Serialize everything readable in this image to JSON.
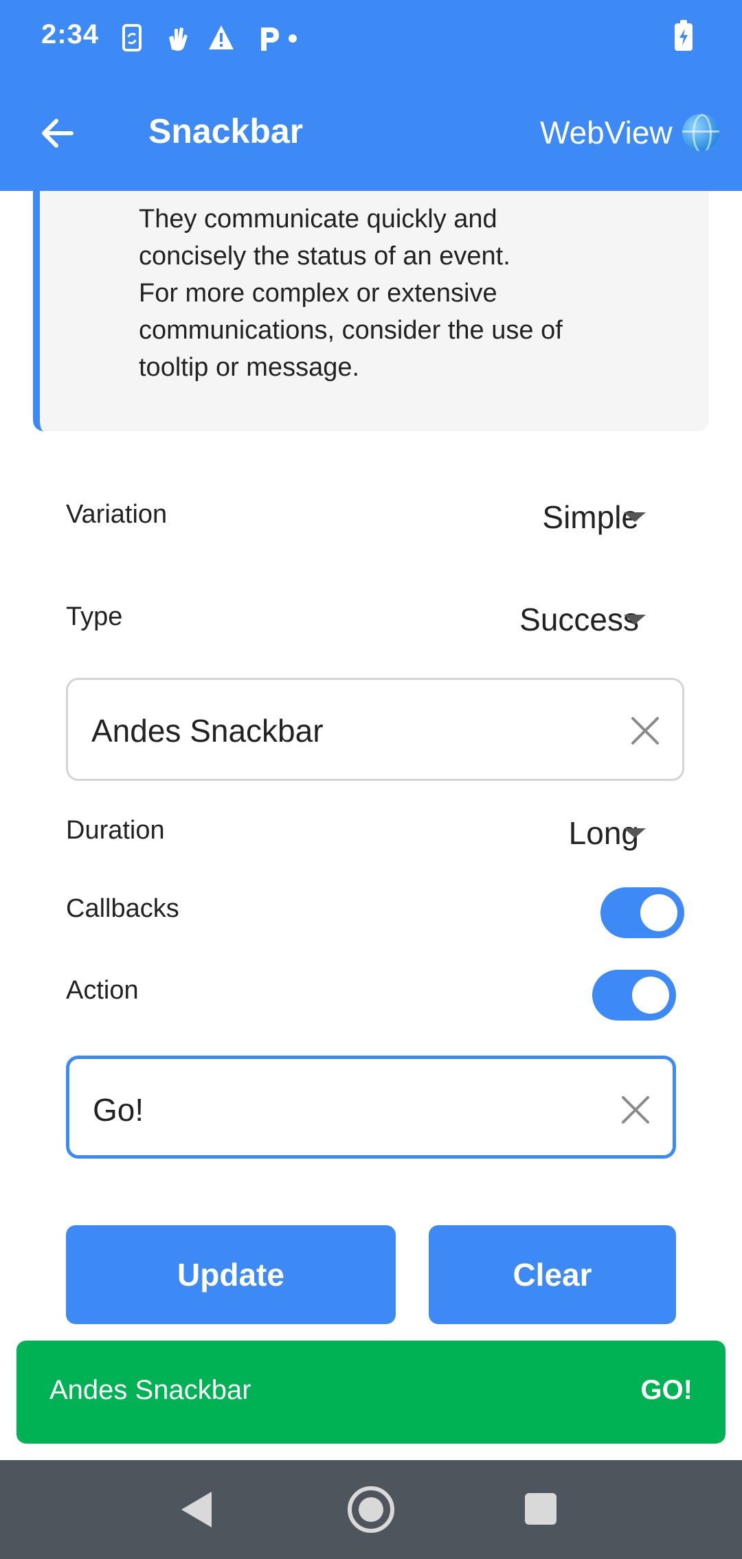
{
  "status_bar": {
    "time": "2:34",
    "icons": [
      "phone-sync-icon",
      "hand-gesture-icon",
      "warning-icon",
      "parking-icon",
      "notification-dot-icon"
    ],
    "battery_icon": "battery-charging-icon"
  },
  "app_bar": {
    "title": "Snackbar",
    "back_icon": "arrow-back-icon",
    "webview_label": "WebView",
    "webview_icon": "globe-icon"
  },
  "info_card": {
    "lines": [
      "They communicate quickly and",
      "concisely the status of an event.",
      "For more complex or extensive",
      "communications, consider the use of",
      "tooltip or message."
    ]
  },
  "form": {
    "variation": {
      "label": "Variation",
      "value": "Simple"
    },
    "type": {
      "label": "Type",
      "value": "Success"
    },
    "text_field": {
      "value": "Andes Snackbar"
    },
    "duration": {
      "label": "Duration",
      "value": "Long"
    },
    "callbacks": {
      "label": "Callbacks",
      "enabled": true
    },
    "action": {
      "label": "Action",
      "enabled": true
    },
    "action_field": {
      "value": "Go!"
    },
    "update_button": "Update",
    "clear_button": "Clear"
  },
  "snackbar": {
    "message": "Andes Snackbar",
    "action": "GO!",
    "color": "#00b253"
  },
  "colors": {
    "accent": "#3d8af7",
    "success": "#00b253",
    "nav_bar": "#4e555c"
  }
}
